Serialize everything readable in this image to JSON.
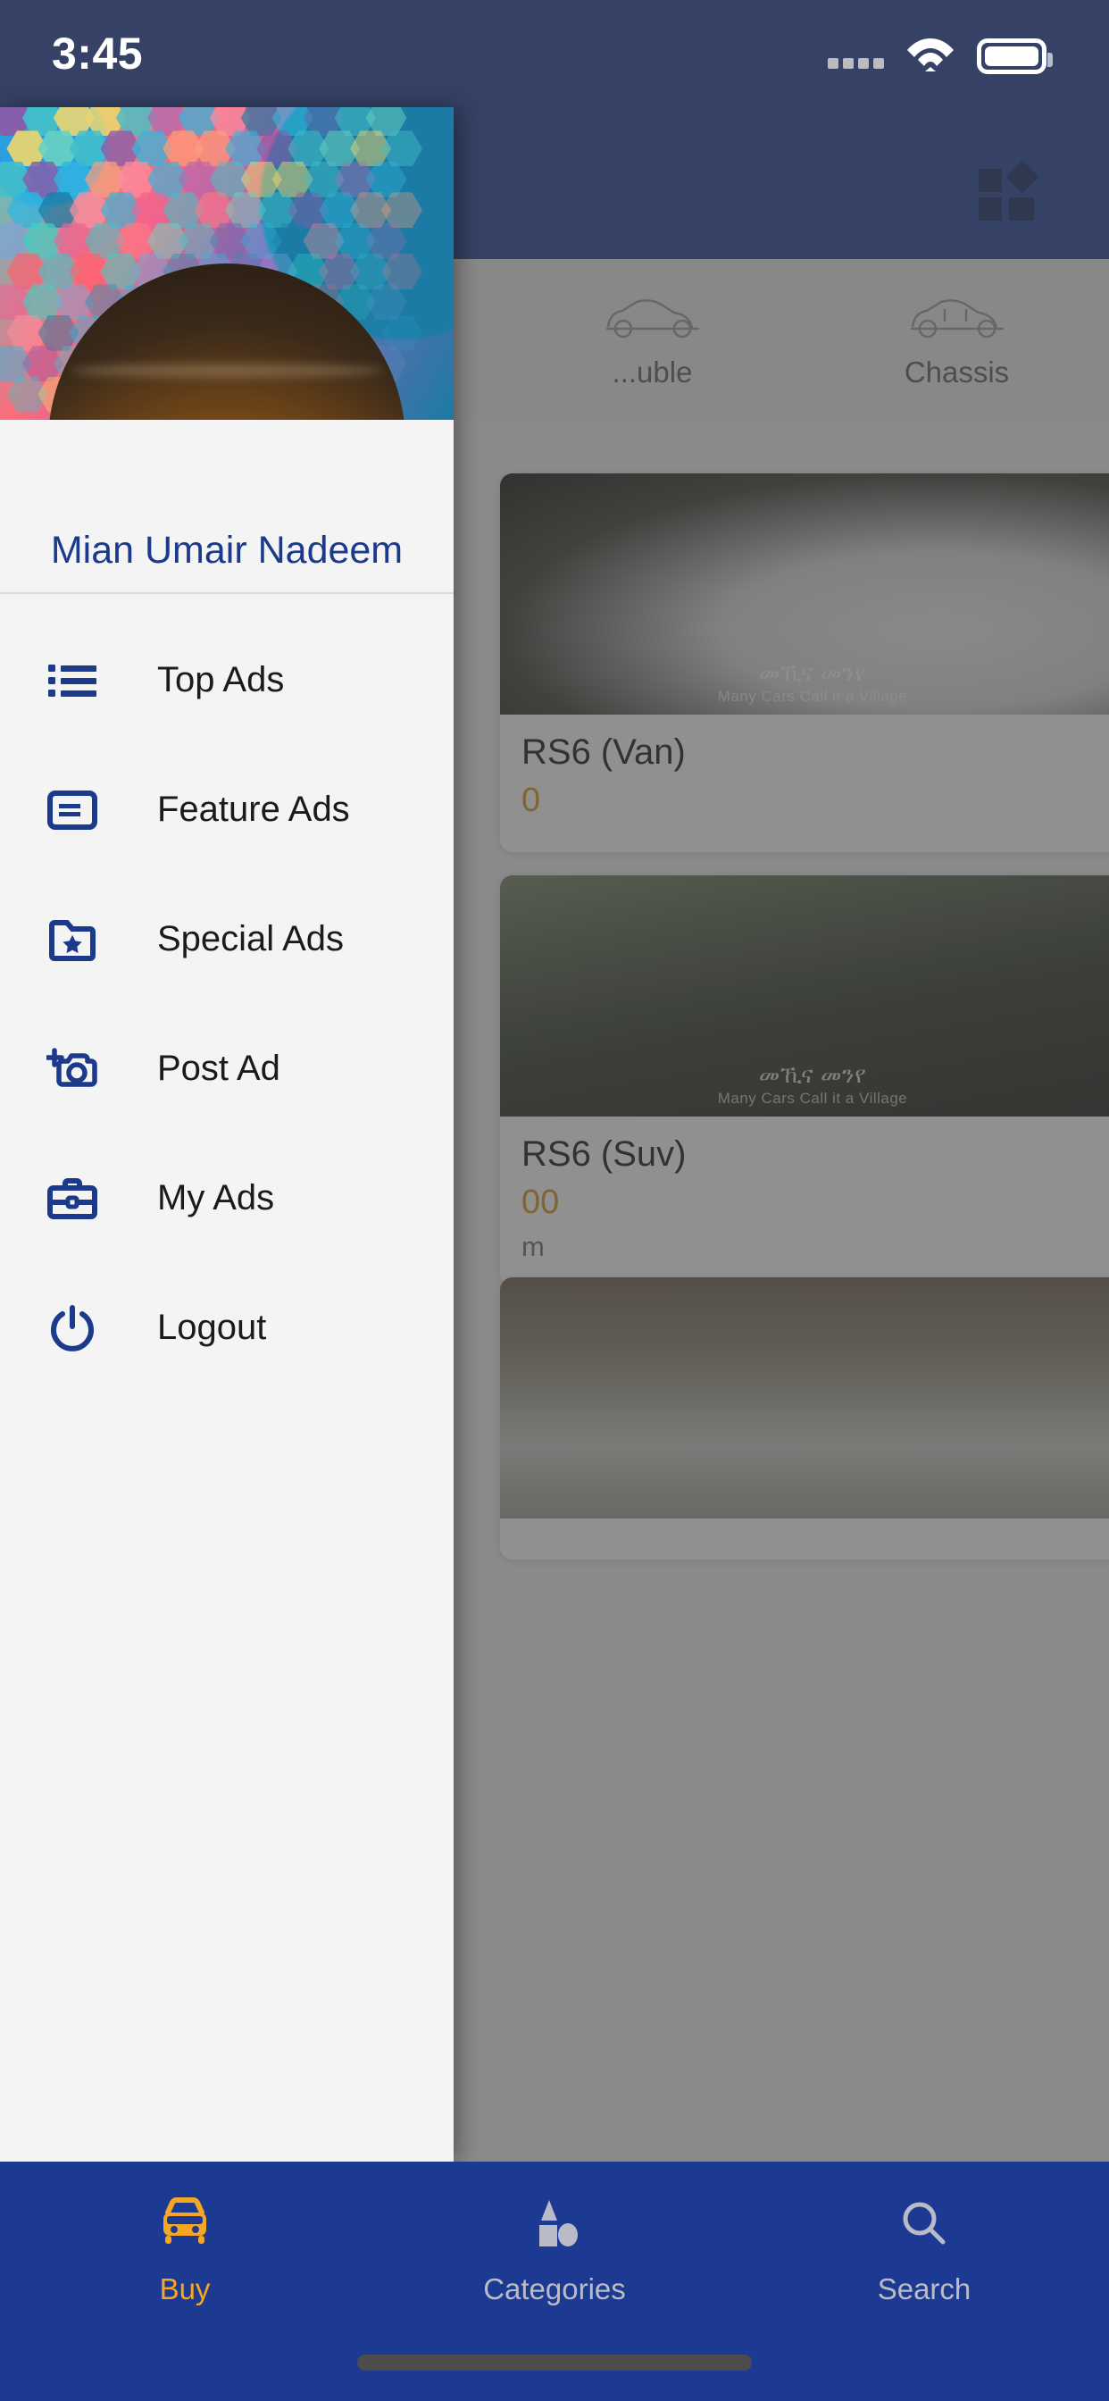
{
  "status_bar": {
    "time": "3:45",
    "signal_icon": "signal-dots-icon",
    "wifi_icon": "wifi-icon",
    "battery_icon": "battery-icon"
  },
  "drawer": {
    "user_name": "Mian Umair Nadeem",
    "avatar_alt": "user-avatar",
    "accent_color": "#1b3a8c",
    "background_color": "#f4f4f4",
    "menu": [
      {
        "label": "Top Ads",
        "icon": "list-icon"
      },
      {
        "label": "Feature Ads",
        "icon": "article-card-icon"
      },
      {
        "label": "Special Ads",
        "icon": "folder-star-icon"
      },
      {
        "label": "Post Ad",
        "icon": "add-photo-camera-icon"
      },
      {
        "label": "My Ads",
        "icon": "briefcase-icon"
      },
      {
        "label": "Logout",
        "icon": "power-icon"
      }
    ]
  },
  "app_screen": {
    "topbar": {
      "grid_icon": "grid-dashboard-icon",
      "color": "#1d3a93"
    },
    "categories": [
      {
        "label": "...uble",
        "icon": "car-outline-icon"
      },
      {
        "label": "Chassis",
        "icon": "car-outline-icon"
      }
    ],
    "listings": [
      {
        "title": "RS6  (Van)",
        "price": "0",
        "meta": "",
        "watermark": "መኺና መንየ",
        "watermark_sub": "Many Cars Call it a Village"
      },
      {
        "title": "RS6  (Suv)",
        "price": "00",
        "meta": "m",
        "watermark": "መኺና መንየ",
        "watermark_sub": "Many Cars Call it a Village"
      },
      {
        "title": "",
        "price": "",
        "meta": "",
        "watermark": "",
        "watermark_sub": ""
      }
    ]
  },
  "bottom_nav": {
    "background_color": "#1d3a93",
    "active_color": "#f5a623",
    "inactive_color": "#b9bcc7",
    "items": [
      {
        "label": "Buy",
        "icon": "car-front-icon",
        "active": true
      },
      {
        "label": "Categories",
        "icon": "shapes-icon",
        "active": false
      },
      {
        "label": "Search",
        "icon": "magnifier-icon",
        "active": false
      }
    ]
  }
}
